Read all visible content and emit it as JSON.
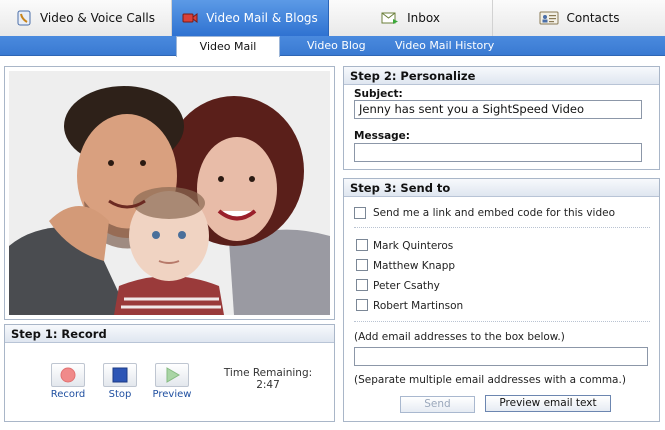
{
  "top_tabs": [
    {
      "label": "Video & Voice Calls",
      "icon": "calls-icon"
    },
    {
      "label": "Video Mail & Blogs",
      "icon": "video-mail-icon"
    },
    {
      "label": "Inbox",
      "icon": "inbox-icon"
    },
    {
      "label": "Contacts",
      "icon": "contacts-icon"
    }
  ],
  "sub_tabs": [
    {
      "label": "Video Mail"
    },
    {
      "label": "Video Blog"
    },
    {
      "label": "Video Mail History"
    }
  ],
  "step1": {
    "title": "Step 1: Record",
    "record_label": "Record",
    "stop_label": "Stop",
    "preview_label": "Preview",
    "time_label": "Time Remaining:",
    "time_value": "2:47"
  },
  "step2": {
    "title": "Step 2: Personalize",
    "subject_label": "Subject:",
    "subject_value": "Jenny has sent you a SightSpeed Video",
    "message_label": "Message:",
    "message_value": ""
  },
  "step3": {
    "title": "Step 3: Send to",
    "send_me_label": "Send me a link and embed code for this video",
    "contacts": [
      "Mark Quinteros",
      "Matthew Knapp",
      "Peter Csathy",
      "Robert Martinson"
    ],
    "add_email_hint": "(Add email addresses to the box below.)",
    "email_value": "",
    "separate_hint": "(Separate multiple email addresses with a comma.)",
    "send_label": "Send",
    "preview_email_label": "Preview email text"
  },
  "colors": {
    "accent_blue": "#3a7ad2",
    "panel_border": "#a9b6c8",
    "link_blue": "#1f4fa0"
  }
}
